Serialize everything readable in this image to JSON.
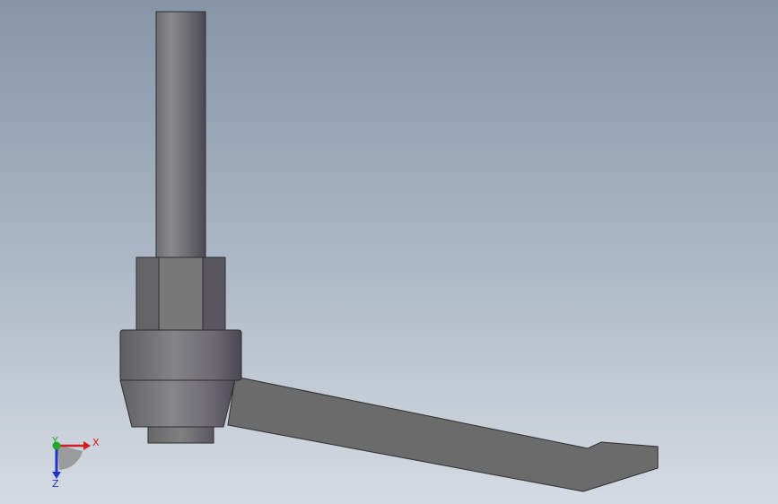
{
  "triad": {
    "x_label": "X",
    "y_label": "Y",
    "z_label": "Z",
    "x_color": "#d21e1e",
    "y_color": "#1faa2a",
    "z_color": "#2233c8"
  },
  "model": {
    "part_color": "#7a7a7a"
  }
}
